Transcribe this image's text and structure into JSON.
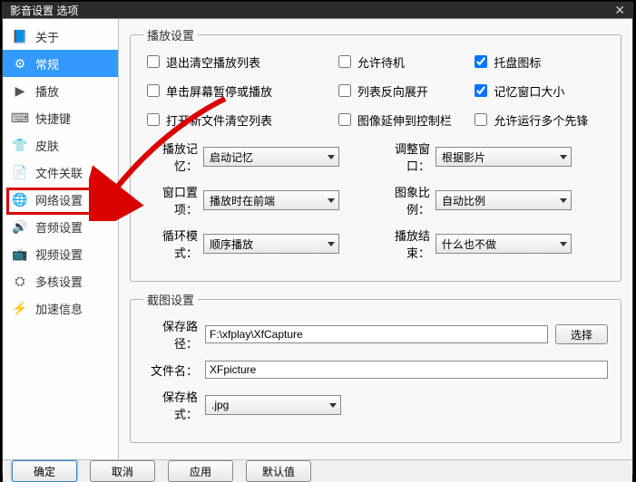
{
  "window": {
    "title": "影音设置 选项"
  },
  "sidebar": {
    "items": [
      {
        "label": "关于"
      },
      {
        "label": "常规"
      },
      {
        "label": "播放"
      },
      {
        "label": "快捷键"
      },
      {
        "label": "皮肤"
      },
      {
        "label": "文件关联"
      },
      {
        "label": "网络设置"
      },
      {
        "label": "音频设置"
      },
      {
        "label": "视频设置"
      },
      {
        "label": "多核设置"
      },
      {
        "label": "加速信息"
      }
    ]
  },
  "playback": {
    "legend": "播放设置",
    "checks": {
      "clear_on_exit": "退出清空播放列表",
      "allow_standby": "允许待机",
      "tray_icon": "托盘图标",
      "click_pause": "单击屏幕暂停或播放",
      "reverse_list": "列表反向展开",
      "remember_size": "记忆窗口大小",
      "clear_on_open": "打开新文件清空列表",
      "stretch_ctrlbar": "图像延伸到控制栏",
      "allow_multi": "允许运行多个先锋"
    },
    "selects": {
      "mem_label": "播放记忆：",
      "mem_value": "启动记忆",
      "resize_label": "调整窗口：",
      "resize_value": "根据影片",
      "wndpos_label": "窗口置项：",
      "wndpos_value": "播放时在前端",
      "ratio_label": "图象比例：",
      "ratio_value": "自动比例",
      "loop_label": "循环模式：",
      "loop_value": "顺序播放",
      "end_label": "播放结束：",
      "end_value": "什么也不做"
    }
  },
  "capture": {
    "legend": "截图设置",
    "path_label": "保存路径：",
    "path_value": "F:\\xfplay\\XfCapture",
    "browse_label": "选择",
    "name_label": "文件名：",
    "name_value": "XFpicture",
    "fmt_label": "保存格式：",
    "fmt_value": ".jpg"
  },
  "footer": {
    "ok": "确定",
    "cancel": "取消",
    "apply": "应用",
    "default": "默认值"
  }
}
